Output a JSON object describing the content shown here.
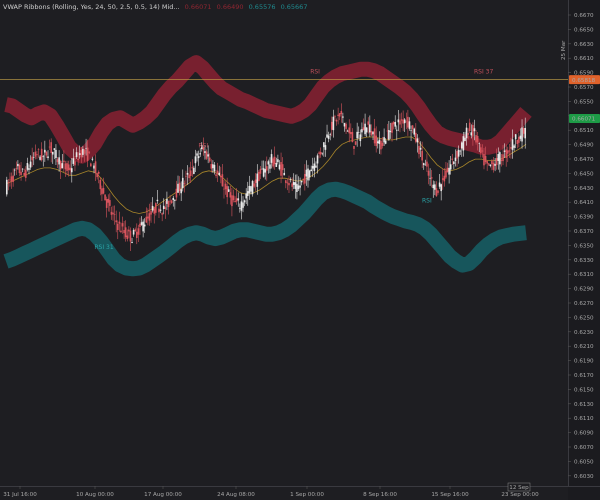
{
  "legend": {
    "indicator": "VWAP Ribbons (Rolling, Yes, 24, 50, 2.5, 0.5, 14) Mid...",
    "v1": "0.66071",
    "v2": "0.66490",
    "v3": "0.65576",
    "v4": "0.65667",
    "c1": "#8f2631",
    "c2": "#8f2631",
    "c3": "#1f8a8e",
    "c4": "#1f8a8e"
  },
  "colors": {
    "background": "#1e1e22",
    "up_candle": "#e8e8e8",
    "down_candle": "#d9545d",
    "upper_band": "#7d2130",
    "lower_band": "#175a60",
    "vwap_line": "#a8862a",
    "price_line": "#c8a448",
    "price_label_bg": "#e0622b",
    "upper_label_bg": "#1d9b46"
  },
  "axis_label_vertical": "25 Mar",
  "price_label": "0.65818",
  "upper_label": "0.66071",
  "x_tick_label_short": "12 Sep",
  "chart_data": {
    "type": "candlestick",
    "title": "VWAP Ribbons (Rolling, Yes, 24, 50, 2.5, 0.5, 14) Mid...",
    "x_ticks": [
      "31 Jul 16:00",
      "10 Aug 00:00",
      "17 Aug 00:00",
      "24 Aug 08:00",
      "1 Sep 00:00",
      "8 Sep 16:00",
      "15 Sep 16:00",
      "23 Sep 00:00"
    ],
    "y_ticks": [
      "0.6670",
      "0.6650",
      "0.6630",
      "0.6610",
      "0.6590",
      "0.6570",
      "0.6550",
      "0.6530",
      "0.6510",
      "0.6490",
      "0.6470",
      "0.6450",
      "0.6430",
      "0.6410",
      "0.6390",
      "0.6370",
      "0.6350",
      "0.6330",
      "0.6310",
      "0.6290",
      "0.6270",
      "0.6250",
      "0.6230",
      "0.6210",
      "0.6190",
      "0.6170",
      "0.6150",
      "0.6130",
      "0.6110",
      "0.6090",
      "0.6070",
      "0.6050",
      "0.6030"
    ],
    "ylim": [
      0.603,
      0.669
    ],
    "last_price": 0.65818,
    "annotations": [
      {
        "text": "RSI",
        "x_index": 0.585,
        "y": 0.659,
        "color": "#c0505a"
      },
      {
        "text": "RSI 37",
        "x_index": 0.9,
        "y": 0.659,
        "color": "#c0505a"
      },
      {
        "text": "RSI",
        "x_index": 0.37,
        "y": 0.649,
        "color": "#c0505a"
      },
      {
        "text": "RSI 31",
        "x_index": 0.17,
        "y": 0.6352,
        "color": "#2aa4a8"
      },
      {
        "text": "RSI",
        "x_index": 0.8,
        "y": 0.6415,
        "color": "#2aa4a8"
      }
    ],
    "series": [
      {
        "name": "Price",
        "values": [
          0.6435,
          0.6448,
          0.646,
          0.6452,
          0.647,
          0.6482,
          0.6476,
          0.649,
          0.6478,
          0.6465,
          0.6458,
          0.6472,
          0.6485,
          0.648,
          0.6462,
          0.644,
          0.6415,
          0.6395,
          0.6382,
          0.6372,
          0.6368,
          0.6378,
          0.639,
          0.64,
          0.6412,
          0.6405,
          0.6418,
          0.643,
          0.6442,
          0.6452,
          0.6472,
          0.6488,
          0.6478,
          0.646,
          0.6445,
          0.6428,
          0.6415,
          0.6412,
          0.6425,
          0.6438,
          0.6452,
          0.6462,
          0.6472,
          0.6468,
          0.6452,
          0.644,
          0.6432,
          0.6446,
          0.646,
          0.6472,
          0.6488,
          0.6512,
          0.6528,
          0.6532,
          0.6512,
          0.6495,
          0.651,
          0.6522,
          0.6508,
          0.6492,
          0.6505,
          0.6518,
          0.6522,
          0.653,
          0.6518,
          0.6496,
          0.6468,
          0.6445,
          0.6432,
          0.6445,
          0.6462,
          0.6478,
          0.6492,
          0.6515,
          0.6508,
          0.648,
          0.6462,
          0.6468,
          0.6475,
          0.6482,
          0.6495,
          0.6505,
          0.6512
        ]
      },
      {
        "name": "Upper band",
        "values": [
          0.6548,
          0.6546,
          0.654,
          0.6534,
          0.653,
          0.6535,
          0.6538,
          0.6533,
          0.652,
          0.6505,
          0.649,
          0.6482,
          0.6478,
          0.6485,
          0.6495,
          0.651,
          0.6522,
          0.6528,
          0.653,
          0.6525,
          0.652,
          0.6524,
          0.653,
          0.6538,
          0.655,
          0.6562,
          0.6572,
          0.658,
          0.659,
          0.66,
          0.6605,
          0.6598,
          0.6588,
          0.6578,
          0.657,
          0.6565,
          0.656,
          0.6555,
          0.6552,
          0.6548,
          0.6544,
          0.654,
          0.6538,
          0.6536,
          0.6534,
          0.6532,
          0.6535,
          0.654,
          0.6548,
          0.656,
          0.6572,
          0.658,
          0.6586,
          0.659,
          0.6592,
          0.6594,
          0.6596,
          0.6596,
          0.6594,
          0.659,
          0.6584,
          0.6578,
          0.6572,
          0.6565,
          0.6556,
          0.6545,
          0.6532,
          0.652,
          0.651,
          0.6505,
          0.6502,
          0.65,
          0.6498,
          0.6495,
          0.6493,
          0.649,
          0.649,
          0.6492,
          0.6498,
          0.6508,
          0.6518,
          0.6528,
          0.6538
        ]
      },
      {
        "name": "Lower band",
        "values": [
          0.6335,
          0.6338,
          0.6342,
          0.6346,
          0.635,
          0.6354,
          0.6358,
          0.6362,
          0.6366,
          0.637,
          0.6374,
          0.6378,
          0.638,
          0.6378,
          0.6372,
          0.6362,
          0.635,
          0.6338,
          0.633,
          0.6326,
          0.6325,
          0.6326,
          0.633,
          0.6336,
          0.6342,
          0.6348,
          0.6355,
          0.6362,
          0.6368,
          0.6372,
          0.6374,
          0.6372,
          0.6368,
          0.6366,
          0.6368,
          0.6372,
          0.6376,
          0.6378,
          0.6378,
          0.6376,
          0.6374,
          0.6372,
          0.6372,
          0.6374,
          0.6378,
          0.6384,
          0.6392,
          0.64,
          0.641,
          0.642,
          0.6428,
          0.6432,
          0.6433,
          0.6431,
          0.6428,
          0.6424,
          0.642,
          0.6416,
          0.641,
          0.6405,
          0.64,
          0.6396,
          0.6393,
          0.639,
          0.6388,
          0.6385,
          0.638,
          0.6372,
          0.6362,
          0.6352,
          0.6342,
          0.6335,
          0.633,
          0.6332,
          0.634,
          0.635,
          0.6358,
          0.6364,
          0.6368,
          0.637,
          0.6372,
          0.6373,
          0.6374
        ]
      },
      {
        "name": "VWAP",
        "values": [
          0.644,
          0.6444,
          0.6448,
          0.6452,
          0.6456,
          0.646,
          0.6462,
          0.6462,
          0.646,
          0.6456,
          0.6452,
          0.6452,
          0.6455,
          0.6458,
          0.6456,
          0.6448,
          0.6436,
          0.6424,
          0.6414,
          0.6406,
          0.6402,
          0.64,
          0.6402,
          0.6406,
          0.6412,
          0.6418,
          0.6424,
          0.643,
          0.6436,
          0.6442,
          0.645,
          0.6456,
          0.6458,
          0.6456,
          0.645,
          0.6442,
          0.6434,
          0.6428,
          0.6426,
          0.6428,
          0.6432,
          0.6438,
          0.6444,
          0.6448,
          0.6448,
          0.6446,
          0.6444,
          0.6446,
          0.645,
          0.6456,
          0.6464,
          0.6474,
          0.6486,
          0.6494,
          0.6498,
          0.65,
          0.6502,
          0.6504,
          0.6504,
          0.6502,
          0.65,
          0.65,
          0.6502,
          0.6504,
          0.6504,
          0.6498,
          0.6488,
          0.6476,
          0.6466,
          0.646,
          0.6458,
          0.646,
          0.6464,
          0.647,
          0.6474,
          0.6474,
          0.6472,
          0.6472,
          0.6474,
          0.6478,
          0.6483,
          0.6488,
          0.6494
        ]
      }
    ]
  }
}
